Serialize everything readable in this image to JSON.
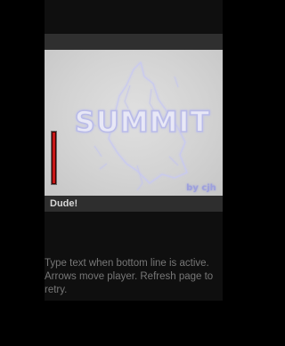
{
  "game": {
    "title_logo": "SUMMIT",
    "byline_logo": "by cjh",
    "chat_line": "Dude!",
    "health_fraction": 1.0,
    "health_color": "#c81818",
    "accent_color": "#f0c000"
  },
  "instructions": "Type text when bottom line is active. Arrows move player. Refresh page to retry."
}
